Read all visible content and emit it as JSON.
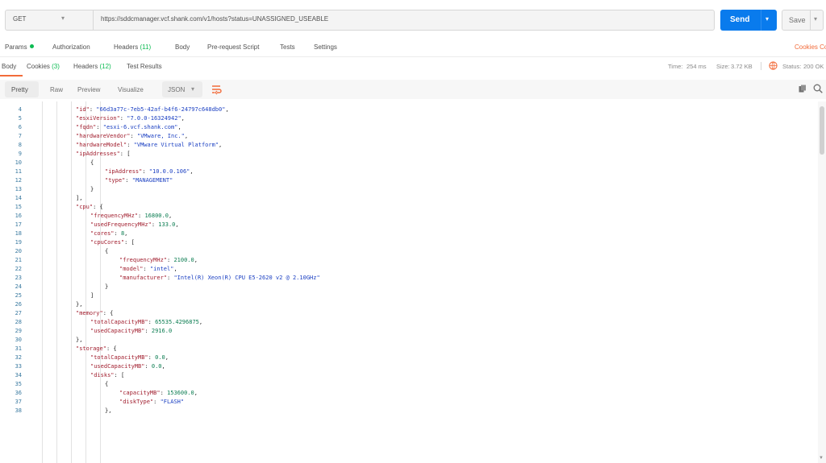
{
  "request": {
    "method": "GET",
    "url": "https://sddcmanager.vcf.shank.com/v1/hosts?status=UNASSIGNED_USEABLE",
    "send_label": "Send",
    "save_label": "Save"
  },
  "request_tabs": [
    {
      "label": "Params"
    },
    {
      "label": "Authorization"
    },
    {
      "label": "Headers",
      "count": "(11)"
    },
    {
      "label": "Body"
    },
    {
      "label": "Pre-request Script"
    },
    {
      "label": "Tests"
    },
    {
      "label": "Settings"
    }
  ],
  "request_right_links": "Cookies  Cod",
  "response_tabs": [
    {
      "label": "Body"
    },
    {
      "label": "Cookies",
      "count": "(3)"
    },
    {
      "label": "Headers",
      "count": "(12)"
    },
    {
      "label": "Test Results"
    }
  ],
  "response_status": {
    "status_label": "Status:",
    "status_value": "200 OK",
    "time_label": "Time:",
    "time_value": "254 ms",
    "size_label": "Size:",
    "size_value": "3.72 KB",
    "save_response": "Save Response"
  },
  "toolbar": {
    "pretty": "Pretty",
    "raw": "Raw",
    "preview": "Preview",
    "visualize": "Visualize",
    "format": "JSON"
  },
  "colors": {
    "accent": "#f26b3a",
    "send": "#097bed",
    "status_ok": "#0cbb52"
  },
  "code_lines": [
    {
      "n": "4",
      "indent": 3,
      "parts": [
        [
          "k",
          "\"id\""
        ],
        [
          "p",
          ": "
        ],
        [
          "s",
          "\"66d3a77c-7eb5-42af-b4f6-24797c648db0\""
        ],
        [
          "p",
          ","
        ]
      ]
    },
    {
      "n": "5",
      "indent": 3,
      "parts": [
        [
          "k",
          "\"esxiVersion\""
        ],
        [
          "p",
          ": "
        ],
        [
          "s",
          "\"7.0.0-16324942\""
        ],
        [
          "p",
          ","
        ]
      ]
    },
    {
      "n": "6",
      "indent": 3,
      "parts": [
        [
          "k",
          "\"fqdn\""
        ],
        [
          "p",
          ": "
        ],
        [
          "s",
          "\"esxi-6.vcf.shank.com\""
        ],
        [
          "p",
          ","
        ]
      ]
    },
    {
      "n": "7",
      "indent": 3,
      "parts": [
        [
          "k",
          "\"hardwareVendor\""
        ],
        [
          "p",
          ": "
        ],
        [
          "s",
          "\"VMware, Inc.\""
        ],
        [
          "p",
          ","
        ]
      ]
    },
    {
      "n": "8",
      "indent": 3,
      "parts": [
        [
          "k",
          "\"hardwareModel\""
        ],
        [
          "p",
          ": "
        ],
        [
          "s",
          "\"VMware Virtual Platform\""
        ],
        [
          "p",
          ","
        ]
      ]
    },
    {
      "n": "9",
      "indent": 3,
      "parts": [
        [
          "k",
          "\"ipAddresses\""
        ],
        [
          "p",
          ": ["
        ]
      ]
    },
    {
      "n": "10",
      "indent": 4,
      "parts": [
        [
          "p",
          "{"
        ]
      ]
    },
    {
      "n": "11",
      "indent": 5,
      "parts": [
        [
          "k",
          "\"ipAddress\""
        ],
        [
          "p",
          ": "
        ],
        [
          "s",
          "\"10.0.0.106\""
        ],
        [
          "p",
          ","
        ]
      ]
    },
    {
      "n": "12",
      "indent": 5,
      "parts": [
        [
          "k",
          "\"type\""
        ],
        [
          "p",
          ": "
        ],
        [
          "s",
          "\"MANAGEMENT\""
        ]
      ]
    },
    {
      "n": "13",
      "indent": 4,
      "parts": [
        [
          "p",
          "}"
        ]
      ]
    },
    {
      "n": "14",
      "indent": 3,
      "parts": [
        [
          "p",
          "],"
        ]
      ]
    },
    {
      "n": "15",
      "indent": 3,
      "parts": [
        [
          "k",
          "\"cpu\""
        ],
        [
          "p",
          ": {"
        ]
      ]
    },
    {
      "n": "16",
      "indent": 4,
      "parts": [
        [
          "k",
          "\"frequencyMHz\""
        ],
        [
          "p",
          ": "
        ],
        [
          "n",
          "16800.0"
        ],
        [
          "p",
          ","
        ]
      ]
    },
    {
      "n": "17",
      "indent": 4,
      "parts": [
        [
          "k",
          "\"usedFrequencyMHz\""
        ],
        [
          "p",
          ": "
        ],
        [
          "n",
          "133.0"
        ],
        [
          "p",
          ","
        ]
      ]
    },
    {
      "n": "18",
      "indent": 4,
      "parts": [
        [
          "k",
          "\"cores\""
        ],
        [
          "p",
          ": "
        ],
        [
          "n",
          "8"
        ],
        [
          "p",
          ","
        ]
      ]
    },
    {
      "n": "19",
      "indent": 4,
      "parts": [
        [
          "k",
          "\"cpuCores\""
        ],
        [
          "p",
          ": ["
        ]
      ]
    },
    {
      "n": "20",
      "indent": 5,
      "parts": [
        [
          "p",
          "{"
        ]
      ]
    },
    {
      "n": "21",
      "indent": 6,
      "parts": [
        [
          "k",
          "\"frequencyMHz\""
        ],
        [
          "p",
          ": "
        ],
        [
          "n",
          "2100.0"
        ],
        [
          "p",
          ","
        ]
      ]
    },
    {
      "n": "22",
      "indent": 6,
      "parts": [
        [
          "k",
          "\"model\""
        ],
        [
          "p",
          ": "
        ],
        [
          "s",
          "\"intel\""
        ],
        [
          "p",
          ","
        ]
      ]
    },
    {
      "n": "23",
      "indent": 6,
      "parts": [
        [
          "k",
          "\"manufacturer\""
        ],
        [
          "p",
          ": "
        ],
        [
          "s",
          "\"Intel(R) Xeon(R) CPU E5-2620 v2 @ 2.10GHz\""
        ]
      ]
    },
    {
      "n": "24",
      "indent": 5,
      "parts": [
        [
          "p",
          "}"
        ]
      ]
    },
    {
      "n": "25",
      "indent": 4,
      "parts": [
        [
          "p",
          "]"
        ]
      ]
    },
    {
      "n": "26",
      "indent": 3,
      "parts": [
        [
          "p",
          "},"
        ]
      ]
    },
    {
      "n": "27",
      "indent": 3,
      "parts": [
        [
          "k",
          "\"memory\""
        ],
        [
          "p",
          ": {"
        ]
      ]
    },
    {
      "n": "28",
      "indent": 4,
      "parts": [
        [
          "k",
          "\"totalCapacityMB\""
        ],
        [
          "p",
          ": "
        ],
        [
          "n",
          "65535.4296875"
        ],
        [
          "p",
          ","
        ]
      ]
    },
    {
      "n": "29",
      "indent": 4,
      "parts": [
        [
          "k",
          "\"usedCapacityMB\""
        ],
        [
          "p",
          ": "
        ],
        [
          "n",
          "2916.0"
        ]
      ]
    },
    {
      "n": "30",
      "indent": 3,
      "parts": [
        [
          "p",
          "},"
        ]
      ]
    },
    {
      "n": "31",
      "indent": 3,
      "parts": [
        [
          "k",
          "\"storage\""
        ],
        [
          "p",
          ": {"
        ]
      ]
    },
    {
      "n": "32",
      "indent": 4,
      "parts": [
        [
          "k",
          "\"totalCapacityMB\""
        ],
        [
          "p",
          ": "
        ],
        [
          "n",
          "0.0"
        ],
        [
          "p",
          ","
        ]
      ]
    },
    {
      "n": "33",
      "indent": 4,
      "parts": [
        [
          "k",
          "\"usedCapacityMB\""
        ],
        [
          "p",
          ": "
        ],
        [
          "n",
          "0.0"
        ],
        [
          "p",
          ","
        ]
      ]
    },
    {
      "n": "34",
      "indent": 4,
      "parts": [
        [
          "k",
          "\"disks\""
        ],
        [
          "p",
          ": ["
        ]
      ]
    },
    {
      "n": "35",
      "indent": 5,
      "parts": [
        [
          "p",
          "{"
        ]
      ]
    },
    {
      "n": "36",
      "indent": 6,
      "parts": [
        [
          "k",
          "\"capacityMB\""
        ],
        [
          "p",
          ": "
        ],
        [
          "n",
          "153600.0"
        ],
        [
          "p",
          ","
        ]
      ]
    },
    {
      "n": "37",
      "indent": 6,
      "parts": [
        [
          "k",
          "\"diskType\""
        ],
        [
          "p",
          ": "
        ],
        [
          "s",
          "\"FLASH\""
        ]
      ]
    },
    {
      "n": "38",
      "indent": 5,
      "parts": [
        [
          "p",
          "},"
        ]
      ]
    }
  ]
}
